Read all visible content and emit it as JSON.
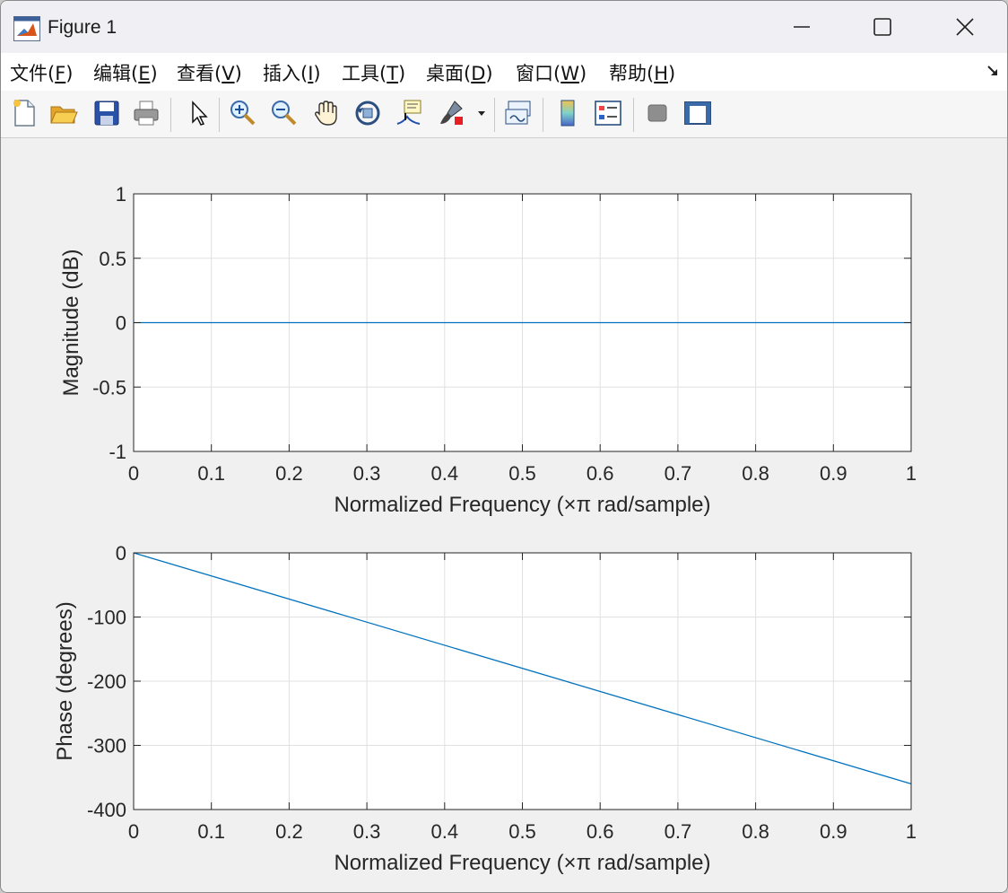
{
  "window": {
    "title": "Figure 1"
  },
  "menu": {
    "items": [
      {
        "label": "文件(",
        "accel": "F",
        "tail": ")"
      },
      {
        "label": "编辑(",
        "accel": "E",
        "tail": ")"
      },
      {
        "label": "查看(",
        "accel": "V",
        "tail": ")"
      },
      {
        "label": "插入(",
        "accel": "I",
        "tail": ")"
      },
      {
        "label": "工具(",
        "accel": "T",
        "tail": ")"
      },
      {
        "label": "桌面(",
        "accel": "D",
        "tail": ")"
      },
      {
        "label": "窗口(",
        "accel": "W",
        "tail": ")"
      },
      {
        "label": "帮助(",
        "accel": "H",
        "tail": ")"
      }
    ]
  },
  "toolbar": {
    "icons": [
      "new-figure-icon",
      "open-file-icon",
      "save-icon",
      "print-icon",
      "pointer-icon",
      "zoom-in-icon",
      "zoom-out-icon",
      "pan-hand-icon",
      "rotate-3d-icon",
      "data-cursor-icon",
      "brush-icon",
      "brush-dropdown-icon",
      "link-plot-icon",
      "colorbar-icon",
      "legend-icon",
      "hide-plot-tools-icon",
      "show-plot-tools-icon"
    ]
  },
  "colors": {
    "line": "#0072bd",
    "grid": "#e0e0e0",
    "axis": "#262626",
    "window_bg": "#f0f0f0"
  },
  "chart_data": [
    {
      "type": "line",
      "title": "",
      "xlabel": "Normalized Frequency  (×π rad/sample)",
      "ylabel": "Magnitude (dB)",
      "xlim": [
        0,
        1
      ],
      "ylim": [
        -1,
        1
      ],
      "xticks": [
        0,
        0.1,
        0.2,
        0.3,
        0.4,
        0.5,
        0.6,
        0.7,
        0.8,
        0.9,
        1
      ],
      "xtick_labels": [
        "0",
        "0.1",
        "0.2",
        "0.3",
        "0.4",
        "0.5",
        "0.6",
        "0.7",
        "0.8",
        "0.9",
        "1"
      ],
      "yticks": [
        -1,
        -0.5,
        0,
        0.5,
        1
      ],
      "ytick_labels": [
        "-1",
        "-0.5",
        "0",
        "0.5",
        "1"
      ],
      "grid": true,
      "series": [
        {
          "x": [
            0,
            1
          ],
          "y": [
            0,
            0
          ]
        }
      ]
    },
    {
      "type": "line",
      "title": "",
      "xlabel": "Normalized Frequency  (×π rad/sample)",
      "ylabel": "Phase (degrees)",
      "xlim": [
        0,
        1
      ],
      "ylim": [
        -400,
        0
      ],
      "xticks": [
        0,
        0.1,
        0.2,
        0.3,
        0.4,
        0.5,
        0.6,
        0.7,
        0.8,
        0.9,
        1
      ],
      "xtick_labels": [
        "0",
        "0.1",
        "0.2",
        "0.3",
        "0.4",
        "0.5",
        "0.6",
        "0.7",
        "0.8",
        "0.9",
        "1"
      ],
      "yticks": [
        -400,
        -300,
        -200,
        -100,
        0
      ],
      "ytick_labels": [
        "-400",
        "-300",
        "-200",
        "-100",
        "0"
      ],
      "grid": true,
      "series": [
        {
          "x": [
            0,
            1
          ],
          "y": [
            0,
            -360
          ]
        }
      ]
    }
  ]
}
